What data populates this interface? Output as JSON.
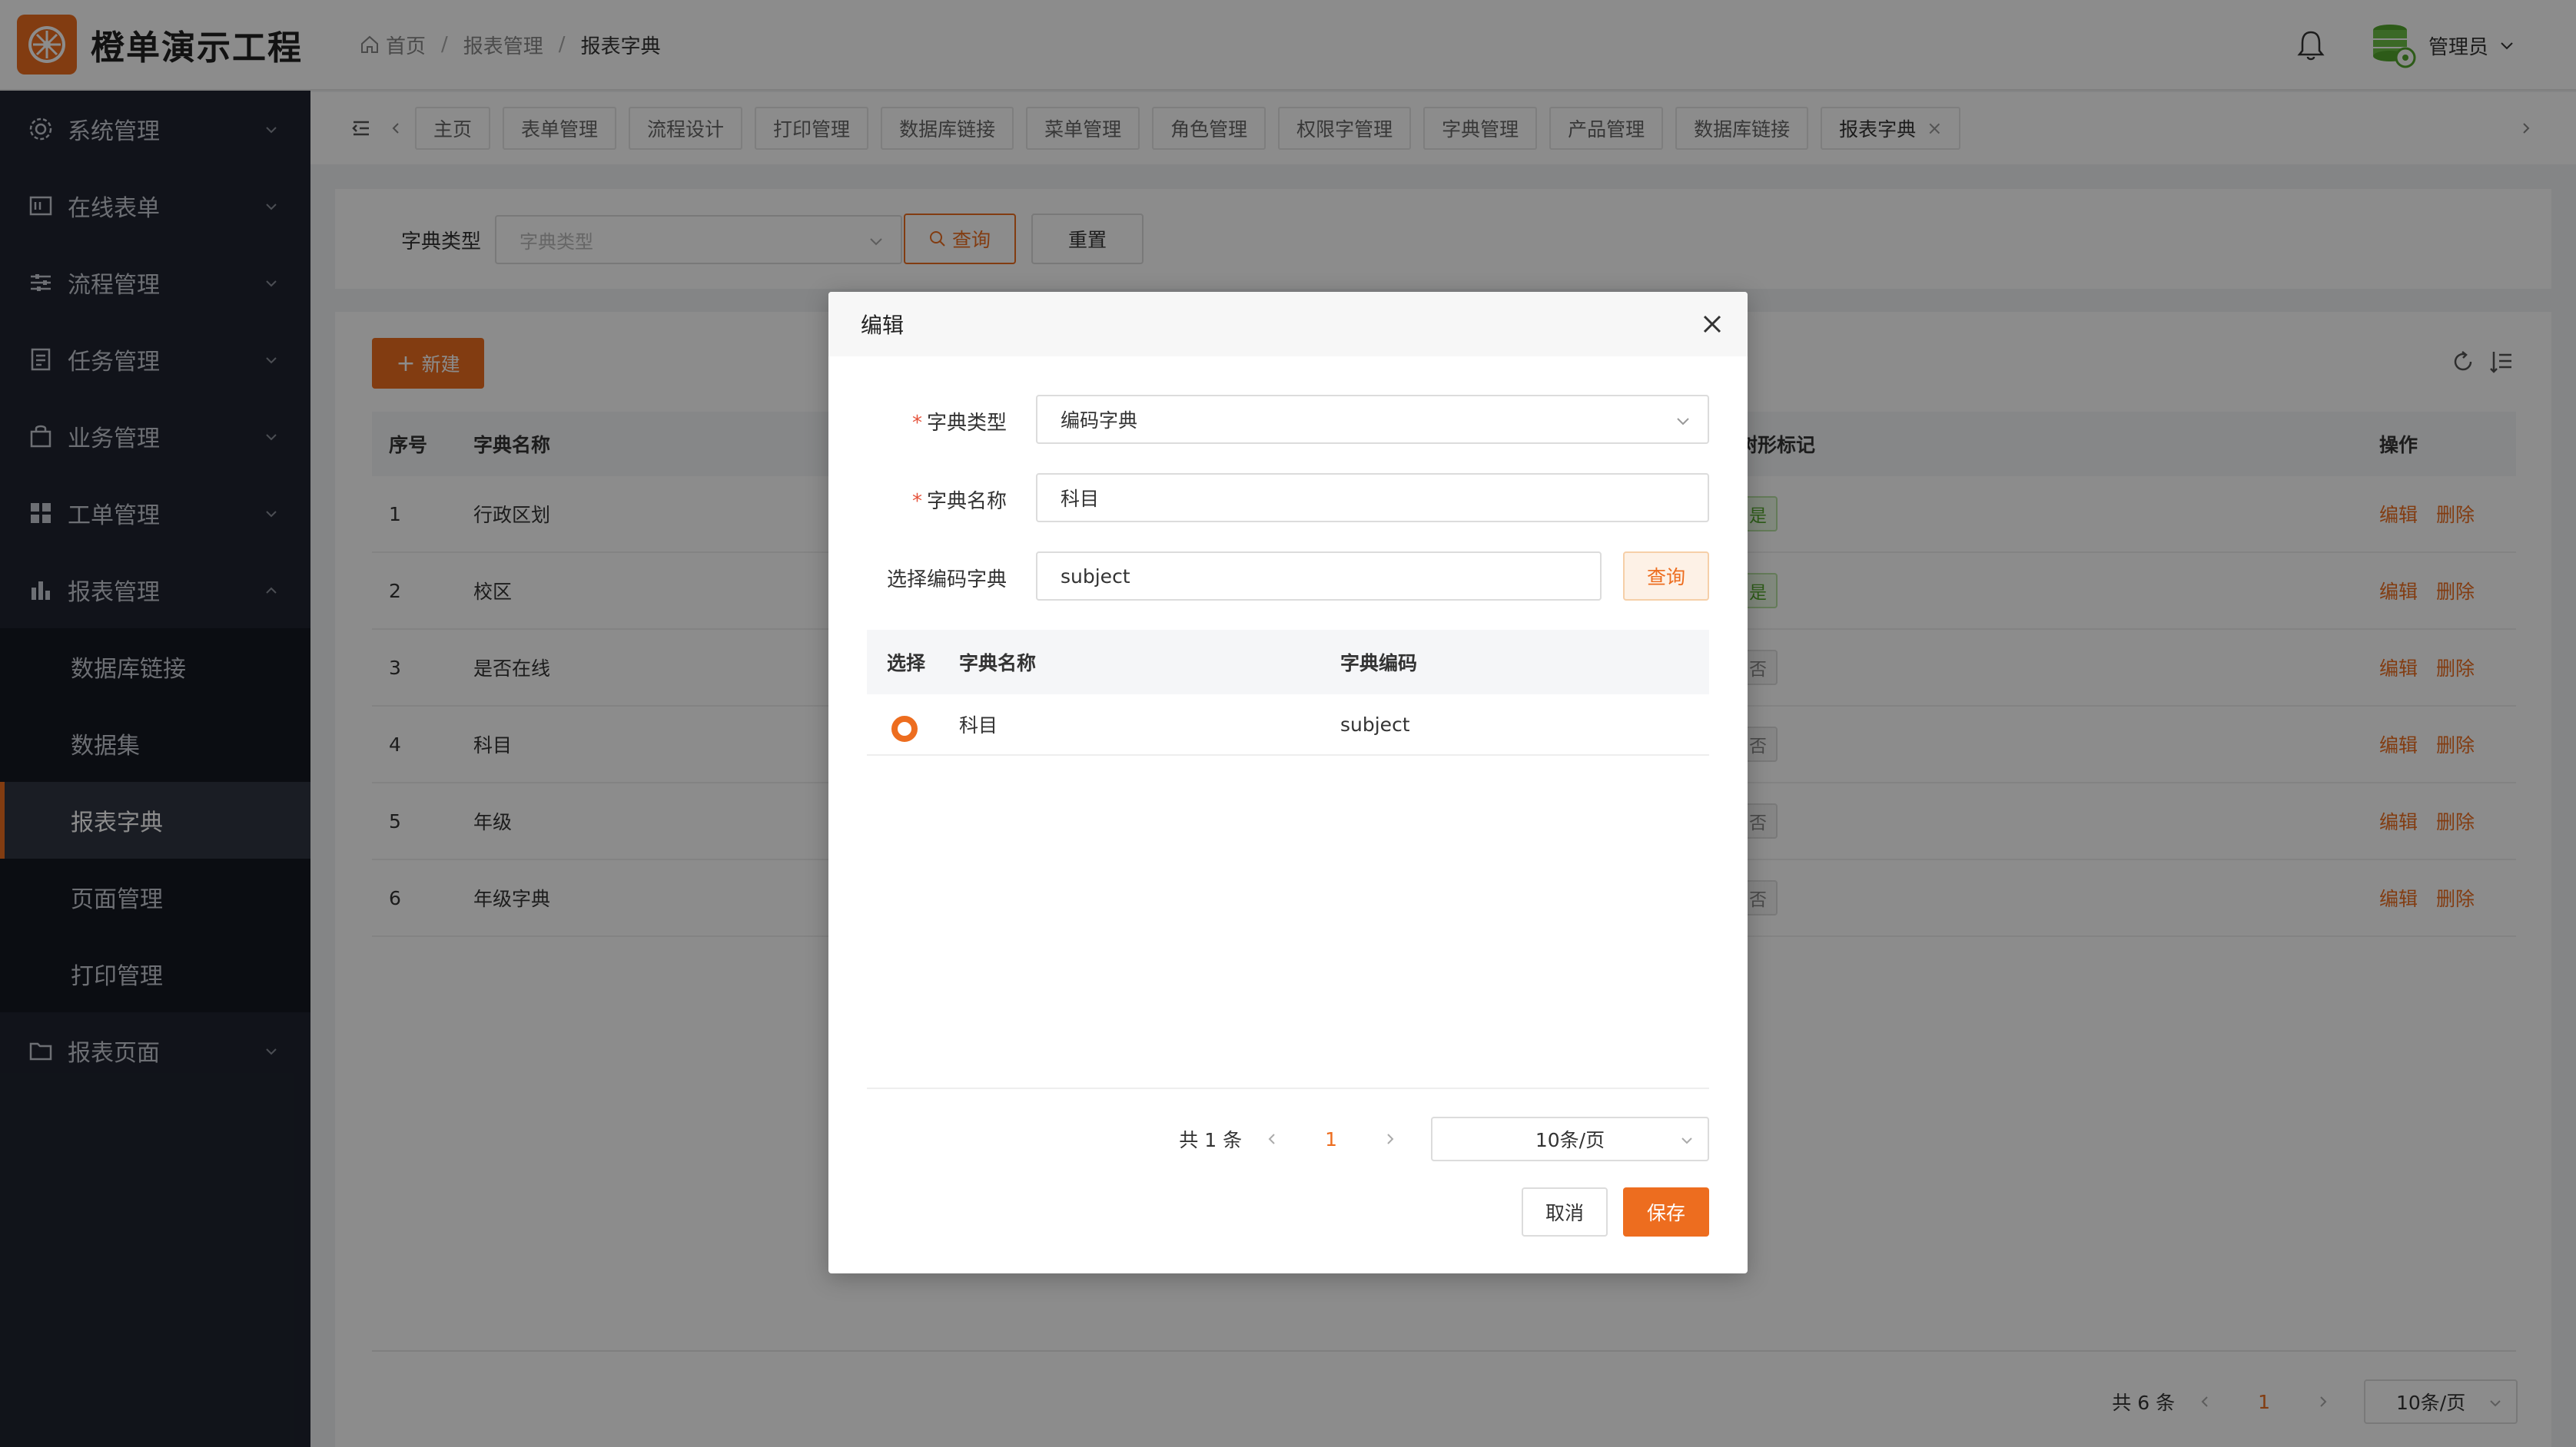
{
  "app": {
    "title": "橙单演示工程"
  },
  "breadcrumb": {
    "home": "首页",
    "parent": "报表管理",
    "current": "报表字典"
  },
  "user": {
    "name": "管理员"
  },
  "sidebar": {
    "items": [
      {
        "label": "系统管理",
        "icon": "gear-icon"
      },
      {
        "label": "在线表单",
        "icon": "form-icon"
      },
      {
        "label": "流程管理",
        "icon": "sliders-icon"
      },
      {
        "label": "任务管理",
        "icon": "task-icon"
      },
      {
        "label": "业务管理",
        "icon": "bag-icon"
      },
      {
        "label": "工单管理",
        "icon": "grid-icon"
      },
      {
        "label": "报表管理",
        "icon": "chart-icon"
      },
      {
        "label": "报表页面",
        "icon": "folder-icon"
      }
    ],
    "sub_items": [
      {
        "label": "数据库链接"
      },
      {
        "label": "数据集"
      },
      {
        "label": "报表字典",
        "active": true
      },
      {
        "label": "页面管理"
      },
      {
        "label": "打印管理"
      }
    ]
  },
  "tabs": [
    {
      "label": "主页"
    },
    {
      "label": "表单管理"
    },
    {
      "label": "流程设计"
    },
    {
      "label": "打印管理"
    },
    {
      "label": "数据库链接"
    },
    {
      "label": "菜单管理"
    },
    {
      "label": "角色管理"
    },
    {
      "label": "权限字管理"
    },
    {
      "label": "字典管理"
    },
    {
      "label": "产品管理"
    },
    {
      "label": "数据库链接"
    },
    {
      "label": "报表字典",
      "active": true,
      "close": "×"
    }
  ],
  "search": {
    "label": "字典类型",
    "placeholder": "字典类型",
    "query_label": "查询",
    "reset_label": "重置"
  },
  "toolbar": {
    "new_label": "新建"
  },
  "table": {
    "headers": {
      "no": "序号",
      "name": "字典名称",
      "flag": "树形标记",
      "op": "操作"
    },
    "rows": [
      {
        "no": "1",
        "name": "行政区划",
        "flag": "是",
        "flag_type": "yes"
      },
      {
        "no": "2",
        "name": "校区",
        "flag": "是",
        "flag_type": "yes"
      },
      {
        "no": "3",
        "name": "是否在线",
        "flag": "否",
        "flag_type": "no"
      },
      {
        "no": "4",
        "name": "科目",
        "flag": "否",
        "flag_type": "no"
      },
      {
        "no": "5",
        "name": "年级",
        "flag": "否",
        "flag_type": "no"
      },
      {
        "no": "6",
        "name": "年级字典",
        "flag": "否",
        "flag_type": "no"
      }
    ],
    "edit_label": "编辑",
    "delete_label": "删除"
  },
  "pager": {
    "total": "共 6 条",
    "current": "1",
    "size": "10条/页"
  },
  "modal": {
    "title": "编辑",
    "fields": {
      "dict_type_label": "字典类型",
      "dict_type_value": "编码字典",
      "dict_name_label": "字典名称",
      "dict_name_value": "科目",
      "code_dict_label": "选择编码字典",
      "code_dict_value": "subject",
      "query_label": "查询"
    },
    "sub_table": {
      "headers": {
        "select": "选择",
        "name": "字典名称",
        "code": "字典编码"
      },
      "rows": [
        {
          "name": "科目",
          "code": "subject",
          "selected": true
        }
      ]
    },
    "pager": {
      "total": "共 1 条",
      "current": "1",
      "size": "10条/页"
    },
    "cancel_label": "取消",
    "save_label": "保存"
  },
  "colors": {
    "accent": "#ed6d1f",
    "sidebar_bg": "#1f2430",
    "submenu_bg": "#141821"
  }
}
